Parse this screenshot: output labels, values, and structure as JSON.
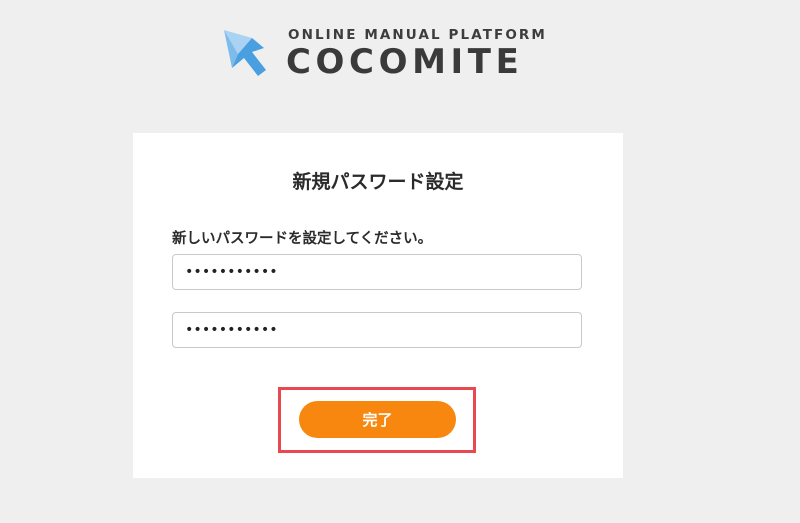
{
  "logo": {
    "tagline": "ONLINE MANUAL PLATFORM",
    "name": "COCOMITE",
    "mark_color": "#4a9fe0",
    "mark_light_color": "#a9d2f3"
  },
  "form": {
    "title": "新規パスワード設定",
    "instruction": "新しいパスワードを設定してください。",
    "password_value": "•••••••••••",
    "password_confirm_value": "•••••••••••",
    "submit_label": "完了",
    "accent_color": "#f7870e",
    "highlight_color": "#e8484f"
  }
}
